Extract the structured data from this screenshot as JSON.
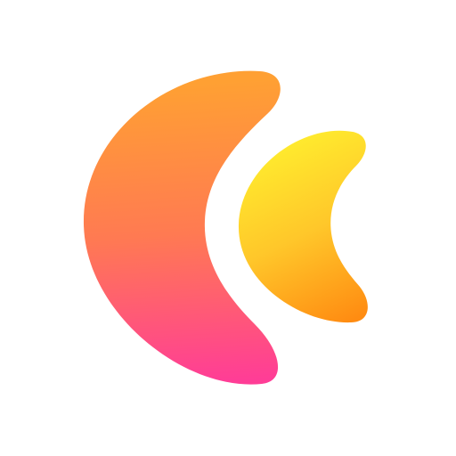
{
  "logo": {
    "icon": "twin-crescent-logo-icon",
    "large_crescent": {
      "icon": "large-crescent-icon",
      "gradient": [
        "#FFA033",
        "#FF7A52",
        "#FF3D96"
      ]
    },
    "small_crescent": {
      "icon": "small-crescent-icon",
      "gradient": [
        "#FFEE2E",
        "#FFC72A",
        "#FF8C12"
      ]
    },
    "background": "#FFFFFF"
  }
}
